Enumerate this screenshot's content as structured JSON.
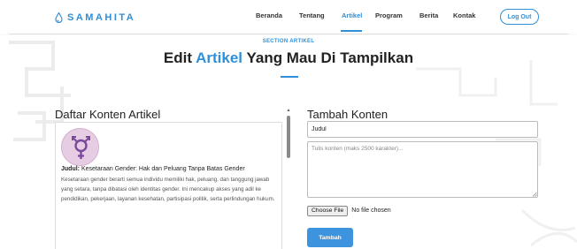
{
  "brand": {
    "name": "SAMAHITA",
    "icon": "water-drop-icon"
  },
  "nav": {
    "links": [
      {
        "label": "Beranda"
      },
      {
        "label": "Tentang"
      },
      {
        "label": "Artikel",
        "active": true
      },
      {
        "label": "Program"
      },
      {
        "label": "Berita"
      },
      {
        "label": "Kontak"
      }
    ],
    "logout_label": "Log Out"
  },
  "header": {
    "section_tag": "SECTION ARTIKEL",
    "title_before": "Edit ",
    "title_accent": "Artikel",
    "title_after": " Yang Mau Di Tampilkan"
  },
  "left": {
    "title": "Daftar Konten Artikel",
    "articles": [
      {
        "image": "gender-symbol-icon",
        "title_label": "Judul:",
        "title": " Kesetaraan Gender: Hak dan Peluang Tanpa Batas Gender",
        "description": "Kesetaraan gender berarti semua individu memiliki hak, peluang, dan tanggung jawab yang setara, tanpa dibatasi oleh identitas gender. Ini mencakup akses yang adil ke pendidikan, pekerjaan, layanan kesehatan, partisipasi politik, serta perlindungan hukum."
      }
    ]
  },
  "right": {
    "title": "Tambah Konten",
    "title_input_value": "Judul",
    "content_placeholder": "Tulis konten (maks 2500 karakter)...",
    "file_button": "Choose File",
    "file_status": "No file chosen",
    "submit_label": "Tambah"
  },
  "colors": {
    "accent": "#2f8fd8",
    "button": "#3d93de"
  }
}
